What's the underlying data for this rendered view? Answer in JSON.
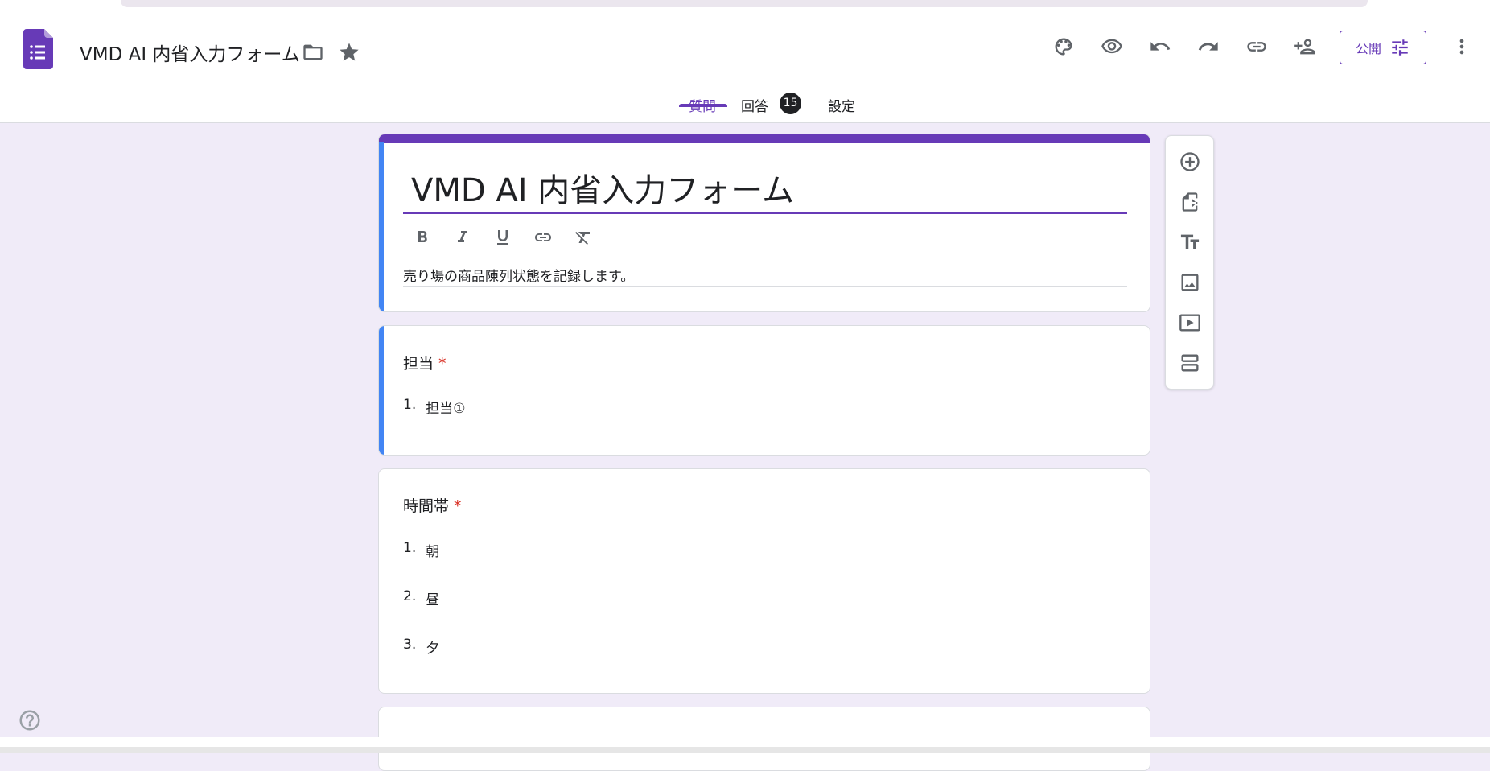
{
  "header": {
    "doc_title": "VMD AI 内省入力フォーム",
    "publish_label": "公開"
  },
  "tabs": [
    {
      "label": "質問",
      "active": true
    },
    {
      "label": "回答",
      "badge": "15"
    },
    {
      "label": "設定"
    }
  ],
  "form": {
    "title": "VMD AI 内省入力フォーム",
    "description": "売り場の商品陳列状態を記録します。"
  },
  "questions": [
    {
      "title": "担当",
      "required_mark": "*",
      "options": [
        {
          "num": "1.",
          "label": "担当①"
        }
      ]
    },
    {
      "title": "時間帯",
      "required_mark": "*",
      "options": [
        {
          "num": "1.",
          "label": "朝"
        },
        {
          "num": "2.",
          "label": "昼"
        },
        {
          "num": "3.",
          "label": "夕"
        }
      ]
    }
  ],
  "colors": {
    "accent": "#673ab7",
    "focus_bar": "#4285f4",
    "background": "#f0ebf8",
    "required": "#d93025"
  },
  "icons": {
    "header": [
      "palette-icon",
      "preview-eye-icon",
      "undo-icon",
      "redo-icon",
      "link-icon",
      "add-collaborator-icon",
      "more-vert-icon"
    ],
    "floating_toolbar": [
      "add-question-icon",
      "import-questions-icon",
      "add-title-icon",
      "add-image-icon",
      "add-video-icon",
      "add-section-icon"
    ]
  }
}
